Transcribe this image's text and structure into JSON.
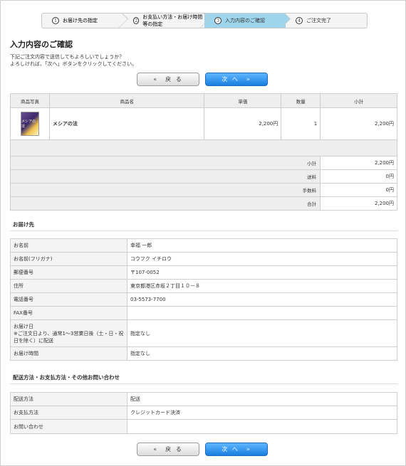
{
  "steps": [
    {
      "num": "1",
      "label": "お届け先の指定"
    },
    {
      "num": "2",
      "label": "お支払い方法・お届け時間等の指定"
    },
    {
      "num": "3",
      "label": "入力内容のご確認"
    },
    {
      "num": "4",
      "label": "ご注文完了"
    }
  ],
  "page_title": "入力内容のご確認",
  "intro_line1": "下記ご注文内容で送信してもよろしいでしょうか？",
  "intro_line2": "よろしければ、「次へ」ボタンをクリックしてください。",
  "buttons": {
    "back": "«　戻 る",
    "next": "次 へ　»"
  },
  "items_table": {
    "headers": [
      "商品写真",
      "商品名",
      "単価",
      "数量",
      "小計"
    ],
    "product": {
      "image_text": "メシアの法",
      "name": "メシアの法",
      "price": "2,200円",
      "qty": "1",
      "subtotal": "2,200円"
    },
    "summary": [
      {
        "label": "小計",
        "value": "2,200円"
      },
      {
        "label": "送料",
        "value": "0円"
      },
      {
        "label": "手数料",
        "value": "0円"
      },
      {
        "label": "合計",
        "value": "2,200円"
      }
    ]
  },
  "delivery": {
    "title": "お届け先",
    "rows": [
      {
        "label": "お名前",
        "value": "幸福 一郎"
      },
      {
        "label": "お名前(フリガナ)",
        "value": "コウフク イチロウ"
      },
      {
        "label": "郵便番号",
        "value": "〒107-0052"
      },
      {
        "label": "住所",
        "value": "東京都港区赤坂２丁目１０－８"
      },
      {
        "label": "電話番号",
        "value": "03-5573-7700"
      },
      {
        "label": "FAX番号",
        "value": ""
      },
      {
        "label": "お届け日",
        "label2": "※ご注文日より、通常1〜3営業日後（土・日・祝日を除く）に配送",
        "value": "指定なし"
      },
      {
        "label": "お届け時間",
        "value": "指定なし"
      }
    ]
  },
  "shipping": {
    "title": "配送方法・お支払方法・その他お問い合わせ",
    "rows": [
      {
        "label": "配送方法",
        "value": "配送"
      },
      {
        "label": "お支払方法",
        "value": "クレジットカード決済"
      },
      {
        "label": "お問い合わせ",
        "value": ""
      }
    ]
  }
}
